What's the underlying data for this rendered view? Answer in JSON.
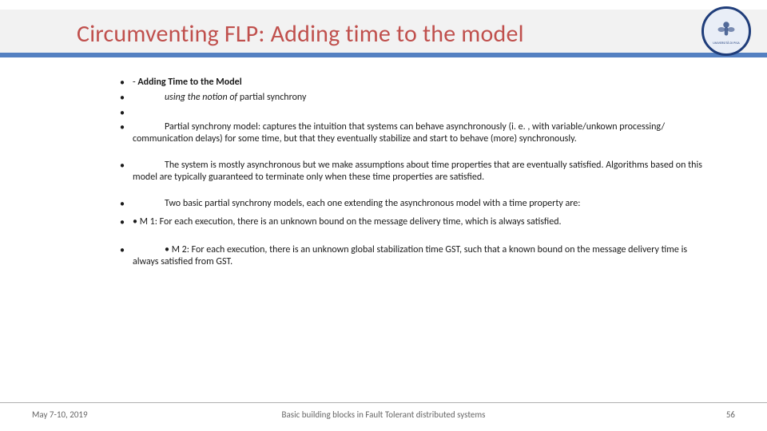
{
  "title": "Circumventing FLP: Adding time to the model",
  "logo": {
    "caption": "UNIVERSITÀ DI PISA"
  },
  "bullets": {
    "b1_prefix": "- ",
    "b1_bold": "Adding Time to the Model",
    "b2_italic": "using the notion of ",
    "b2_tail": "partial synchrony",
    "b3": "Partial synchrony model: captures the intuition that systems can behave asynchronously (i. e. , with variable/unkown processing/ communication delays) for some time, but that they eventually stabilize and start to behave (more) synchronously.",
    "b4": "The system is mostly asynchronous but we make assumptions about time properties that are eventually satisfied. Algorithms based on this model are typically guaranteed to terminate only when these time properties are satisfied.",
    "b5": "Two basic partial synchrony models, each one extending the asynchronous model with a time property are:",
    "b6": "• M 1: For each execution, there is an unknown bound on the message delivery time, which is always satisfied.",
    "b7": "• M 2: For each execution, there is an unknown global stabilization time GST, such that a known bound on the message delivery time  is always satisfied from GST."
  },
  "footer": {
    "left": "May 7-10, 2019",
    "center": "Basic building blocks in Fault Tolerant distributed systems",
    "right": "56"
  }
}
